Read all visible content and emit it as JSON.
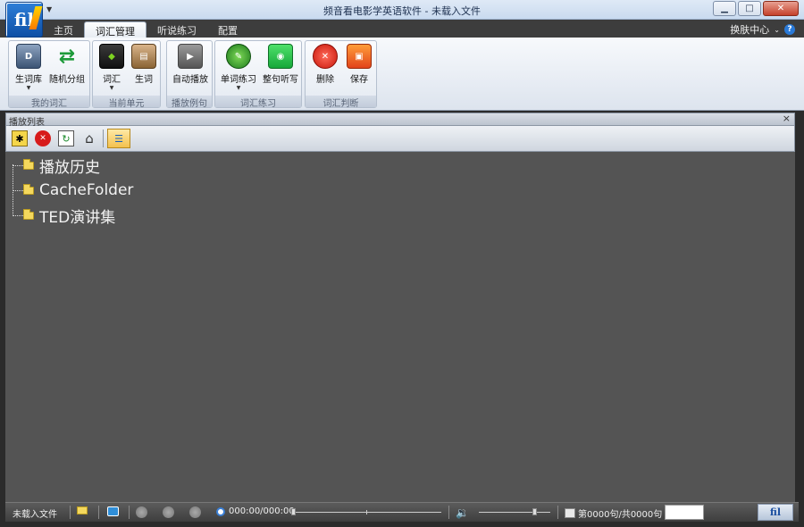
{
  "window": {
    "title": "频音看电影学英语软件 - 未载入文件",
    "logo_text": "fil",
    "buttons": [
      "minimize",
      "maximize",
      "close"
    ]
  },
  "tabs": [
    {
      "label": "主页",
      "active": false
    },
    {
      "label": "词汇管理",
      "active": true
    },
    {
      "label": "听说练习",
      "active": false
    },
    {
      "label": "配置",
      "active": false
    }
  ],
  "skin_center": "换肤中心",
  "ribbon": {
    "groups": [
      {
        "title": "我的词汇",
        "buttons": [
          {
            "label": "生词库",
            "icon": "book-icon",
            "dropdown": true
          },
          {
            "label": "随机分组",
            "icon": "shuffle-icon",
            "dropdown": false
          }
        ]
      },
      {
        "title": "当前单元",
        "buttons": [
          {
            "label": "词汇",
            "icon": "vocab-icon",
            "dropdown": true
          },
          {
            "label": "生词",
            "icon": "new-word-icon",
            "dropdown": false
          }
        ]
      },
      {
        "title": "播放例句",
        "buttons": [
          {
            "label": "自动播放",
            "icon": "play-icon",
            "dropdown": false
          }
        ]
      },
      {
        "title": "词汇练习",
        "buttons": [
          {
            "label": "单词练习",
            "icon": "word-practice-icon",
            "dropdown": true
          },
          {
            "label": "整句听写",
            "icon": "dictation-icon",
            "dropdown": false
          }
        ]
      },
      {
        "title": "词汇判断",
        "buttons": [
          {
            "label": "删除",
            "icon": "delete-icon",
            "dropdown": false
          },
          {
            "label": "保存",
            "icon": "save-icon",
            "dropdown": false
          }
        ]
      }
    ]
  },
  "playlist": {
    "title": "播放列表",
    "close": "×",
    "toolbar": [
      "new-folder-icon",
      "delete-icon",
      "refresh-icon",
      "home-icon",
      "list-view-icon"
    ],
    "tree_items": [
      "播放历史",
      "CacheFolder",
      "TED演讲集"
    ]
  },
  "status": {
    "file_state": "未载入文件",
    "time": "000:00/000:00",
    "sentence_counter": "第0000句/共0000句",
    "progress": 0,
    "volume": 0.8
  }
}
